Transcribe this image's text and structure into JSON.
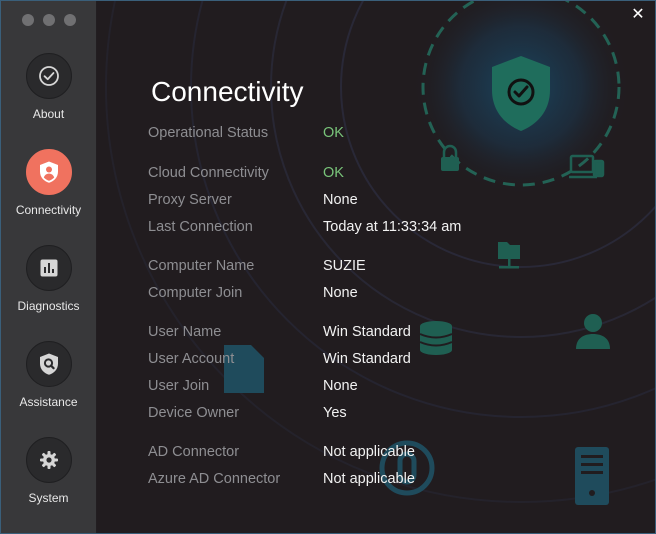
{
  "window": {
    "close_glyph": "✕"
  },
  "sidebar": {
    "items": [
      {
        "label": "About",
        "icon": "check-circle-icon",
        "active": false
      },
      {
        "label": "Connectivity",
        "icon": "shield-user-icon",
        "active": true
      },
      {
        "label": "Diagnostics",
        "icon": "bar-chart-icon",
        "active": false
      },
      {
        "label": "Assistance",
        "icon": "shield-search-icon",
        "active": false
      },
      {
        "label": "System",
        "icon": "gear-icon",
        "active": false
      }
    ]
  },
  "page": {
    "title": "Connectivity",
    "rows": [
      {
        "label": "Operational Status",
        "value": "OK",
        "status": "ok"
      },
      {
        "label": "Cloud Connectivity",
        "value": "OK",
        "status": "ok"
      },
      {
        "label": "Proxy Server",
        "value": "None"
      },
      {
        "label": "Last Connection",
        "value": "Today at 11:33:34 am"
      },
      {
        "label": "Computer Name",
        "value": "SUZIE"
      },
      {
        "label": "Computer Join",
        "value": "None"
      },
      {
        "label": "User Name",
        "value": "Win Standard"
      },
      {
        "label": "User Account",
        "value": "Win Standard"
      },
      {
        "label": "User Join",
        "value": "None"
      },
      {
        "label": "Device Owner",
        "value": "Yes"
      },
      {
        "label": "AD Connector",
        "value": "Not applicable"
      },
      {
        "label": "Azure AD Connector",
        "value": "Not applicable"
      }
    ]
  },
  "colors": {
    "accent": "#f0725f",
    "ok": "#79c47a",
    "sidebar_bg": "#38383a",
    "main_bg": "#211c1f",
    "shield_green": "#1f6d5c"
  }
}
